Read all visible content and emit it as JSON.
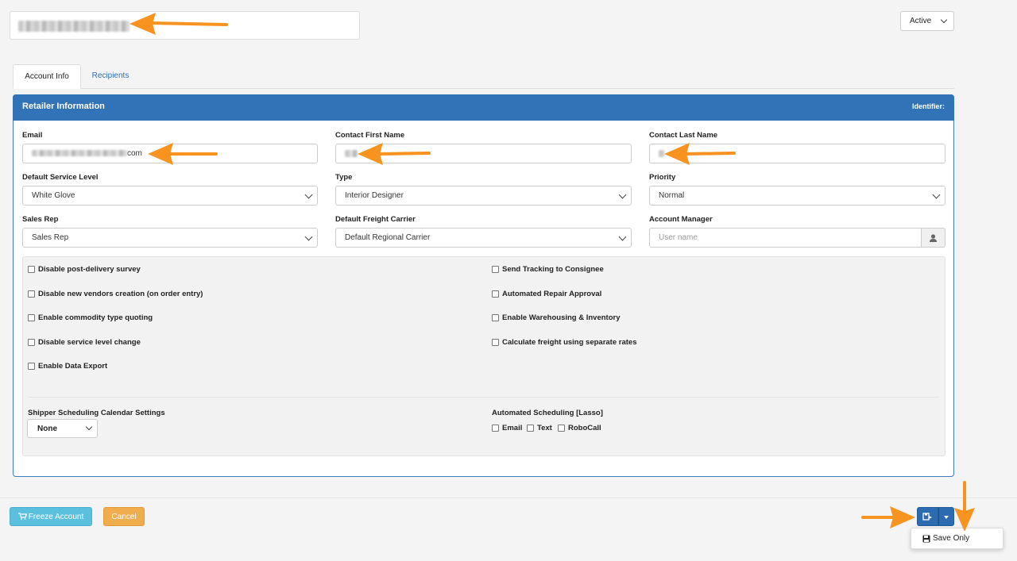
{
  "header": {
    "status_select_value": "Active"
  },
  "tabs": [
    {
      "label": "Account Info"
    },
    {
      "label": "Recipients"
    }
  ],
  "panel": {
    "title": "Retailer Information",
    "identifier_label": "Identifier:"
  },
  "fields": {
    "email": {
      "label": "Email",
      "value_suffix": "com"
    },
    "contact_first_name": {
      "label": "Contact First Name"
    },
    "contact_last_name": {
      "label": "Contact Last Name"
    },
    "default_service_level": {
      "label": "Default Service Level",
      "value": "White Glove"
    },
    "type": {
      "label": "Type",
      "value": "Interior Designer"
    },
    "priority": {
      "label": "Priority",
      "value": "Normal"
    },
    "sales_rep": {
      "label": "Sales Rep",
      "value": "Sales Rep"
    },
    "default_freight_carrier": {
      "label": "Default Freight Carrier",
      "value": "Default Regional Carrier"
    },
    "account_manager": {
      "label": "Account Manager",
      "placeholder": "User name"
    }
  },
  "checkboxes_left": [
    "Disable post-delivery survey",
    "Disable new vendors creation (on order entry)",
    "Enable commodity type quoting",
    "Disable service level change",
    "Enable Data Export"
  ],
  "checkboxes_right": [
    "Send Tracking to Consignee",
    "Automated Repair Approval",
    "Enable Warehousing & Inventory",
    "Calculate freight using separate rates"
  ],
  "scheduling": {
    "calendar_label": "Shipper Scheduling Calendar Settings",
    "calendar_value": "None",
    "automated_label": "Automated Scheduling [Lasso]",
    "options": [
      "Email",
      "Text",
      "RoboCall"
    ]
  },
  "footer": {
    "freeze_label": "Freeze Account",
    "cancel_label": "Cancel",
    "save_only_label": "Save Only"
  },
  "colors": {
    "primary": "#3173b6",
    "info": "#5bc0de",
    "warning": "#f0ad4e",
    "annotation_arrow": "#f7931e"
  }
}
